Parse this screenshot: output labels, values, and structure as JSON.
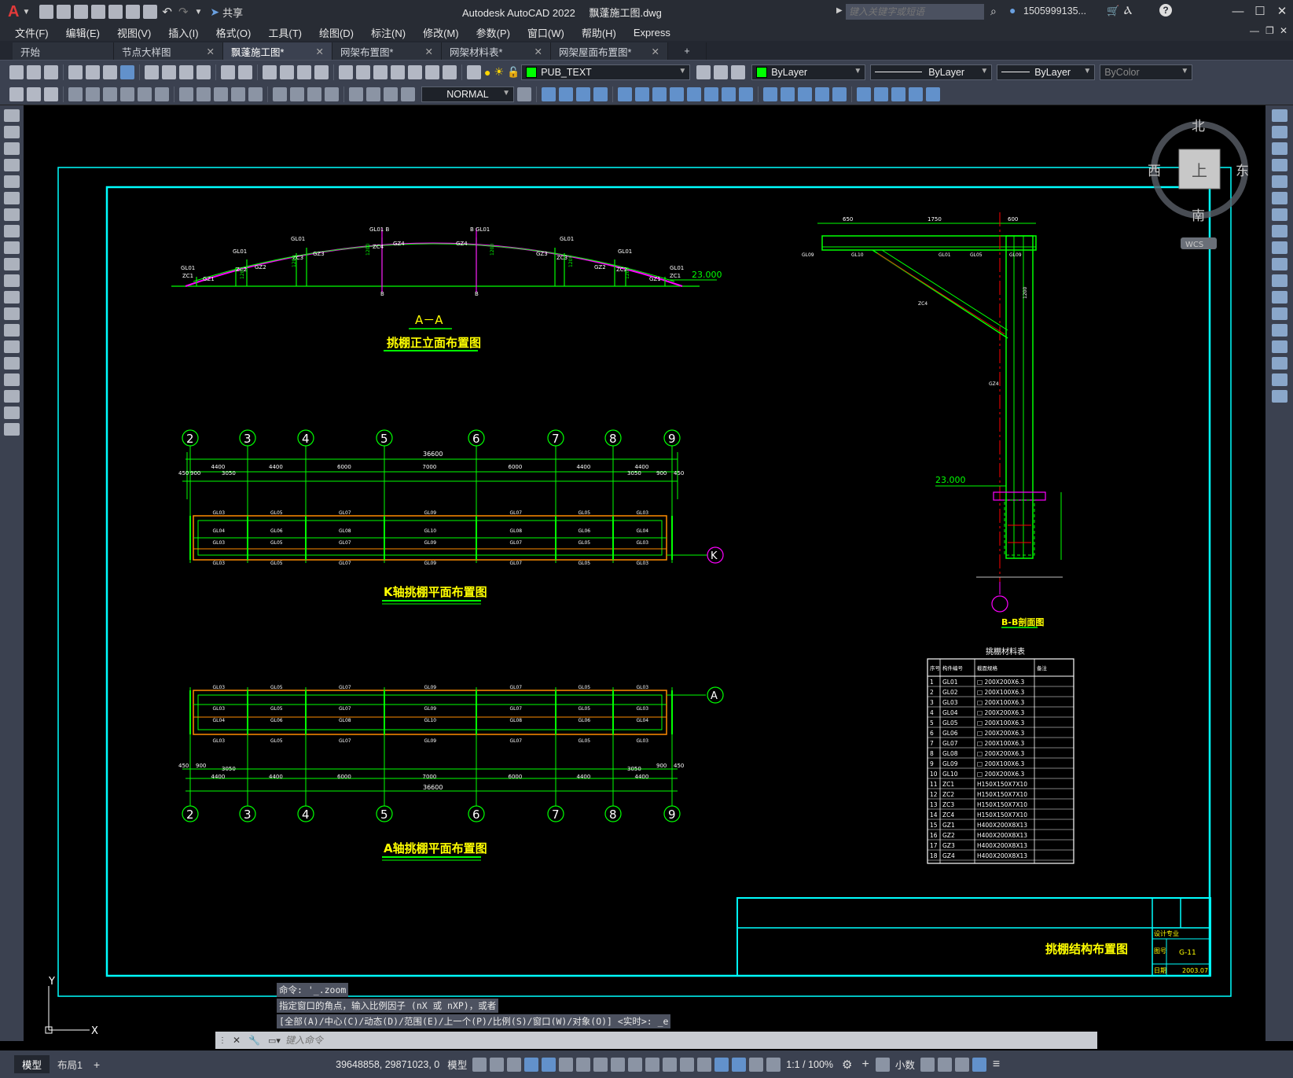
{
  "app": {
    "title": "Autodesk AutoCAD 2022",
    "filename": "飘蓬施工图.dwg",
    "share_label": "共享",
    "search_placeholder": "键入关键字或短语",
    "user": "1505999135...",
    "logo": "A"
  },
  "menu": [
    "文件(F)",
    "编辑(E)",
    "视图(V)",
    "插入(I)",
    "格式(O)",
    "工具(T)",
    "绘图(D)",
    "标注(N)",
    "修改(M)",
    "参数(P)",
    "窗口(W)",
    "帮助(H)",
    "Express"
  ],
  "tabs": [
    {
      "label": "开始",
      "close": false,
      "active": false
    },
    {
      "label": "节点大样图",
      "close": true,
      "active": false
    },
    {
      "label": "飘蓬施工图*",
      "close": true,
      "active": true
    },
    {
      "label": "网架布置图*",
      "close": true,
      "active": false
    },
    {
      "label": "网架材料表*",
      "close": true,
      "active": false
    },
    {
      "label": "网架屋面布置图*",
      "close": true,
      "active": false
    }
  ],
  "toolbar": {
    "layer": "PUB_TEXT",
    "color": "ByLayer",
    "linetype": "ByLayer",
    "lineweight": "ByLayer",
    "plotstyle": "ByColor",
    "dimstyle": "NORMAL"
  },
  "viewcube": {
    "north": "北",
    "south": "南",
    "east": "东",
    "west": "西",
    "top": "上",
    "wcs": "WCS"
  },
  "drawing": {
    "elevation_title": "A－A",
    "elevation_subtitle": "挑棚正立面布置图",
    "elev_level": "23.000",
    "k_plan_title": "K轴挑棚平面布置图",
    "a_plan_title": "A轴挑棚平面布置图",
    "section_title": "B-B剖面图",
    "section_level": "23.000",
    "table_title": "挑棚材料表",
    "sheet_title": "挑棚结构布置图",
    "sheet_design": "设计专业",
    "sheet_no_label": "图号",
    "sheet_no": "G-11",
    "sheet_date_label": "日期",
    "sheet_date": "2003.07",
    "axis_k": "K",
    "axis_a": "A",
    "grid_numbers": [
      "2",
      "3",
      "4",
      "5",
      "6",
      "7",
      "8",
      "9"
    ],
    "total_dim": "36600",
    "bay_dims": [
      "4400",
      "4400",
      "6000",
      "7000",
      "6000",
      "4400",
      "4400"
    ],
    "edge_dims": [
      "450",
      "900",
      "3050",
      "3050",
      "900",
      "450"
    ],
    "beam_labels_outer": [
      "GL03",
      "GL05",
      "GL07",
      "GL09",
      "GL07",
      "GL05",
      "GL03"
    ],
    "beam_labels_inner1": [
      "GL04",
      "GL06",
      "GL08",
      "GL10",
      "GL08",
      "GL06",
      "GL04"
    ],
    "beam_labels_inner2": [
      "GL03",
      "GL05",
      "GL07",
      "GL09",
      "GL07",
      "GL05",
      "GL03"
    ],
    "section_dims": [
      "650",
      "1750",
      "600"
    ],
    "section_labels": [
      "GL09",
      "GL10",
      "GL01",
      "GL05",
      "GL09",
      "ZC4",
      "GZ4",
      "1200"
    ],
    "table": {
      "headers": [
        "序号",
        "构件编号",
        "截面规格",
        "备注"
      ],
      "rows": [
        [
          "1",
          "GL01",
          "□ 200X200X6.3"
        ],
        [
          "2",
          "GL02",
          "□ 200X100X6.3"
        ],
        [
          "3",
          "GL03",
          "□ 200X100X6.3"
        ],
        [
          "4",
          "GL04",
          "□ 200X200X6.3"
        ],
        [
          "5",
          "GL05",
          "□ 200X100X6.3"
        ],
        [
          "6",
          "GL06",
          "□ 200X200X6.3"
        ],
        [
          "7",
          "GL07",
          "□ 200X100X6.3"
        ],
        [
          "8",
          "GL08",
          "□ 200X200X6.3"
        ],
        [
          "9",
          "GL09",
          "□ 200X100X6.3"
        ],
        [
          "10",
          "GL10",
          "□ 200X200X6.3"
        ],
        [
          "11",
          "ZC1",
          "H150X150X7X10"
        ],
        [
          "12",
          "ZC2",
          "H150X150X7X10"
        ],
        [
          "13",
          "ZC3",
          "H150X150X7X10"
        ],
        [
          "14",
          "ZC4",
          "H150X150X7X10"
        ],
        [
          "15",
          "GZ1",
          "H400X200X8X13"
        ],
        [
          "16",
          "GZ2",
          "H400X200X8X13"
        ],
        [
          "17",
          "GZ3",
          "H400X200X8X13"
        ],
        [
          "18",
          "GZ4",
          "H400X200X8X13"
        ]
      ]
    }
  },
  "command": {
    "history": [
      "命令: '_.zoom",
      "指定窗口的角点，输入比例因子 (nX 或 nXP)，或者",
      "[全部(A)/中心(C)/动态(D)/范围(E)/上一个(P)/比例(S)/窗口(W)/对象(O)] <实时>: _e"
    ],
    "placeholder": "键入命令"
  },
  "ucs": {
    "y": "Y",
    "x": "X"
  },
  "status": {
    "model_tab": "模型",
    "layout_tab": "布局1",
    "coords": "39648858, 29871023, 0",
    "model": "模型",
    "scale": "1:1 / 100%",
    "units": "小数"
  },
  "colors": {
    "frame": "#00ffff",
    "green": "#00ff00",
    "yellow": "#ffff00",
    "magenta": "#ff00ff",
    "red": "#ff0000",
    "ui_bg": "#3b4150"
  }
}
